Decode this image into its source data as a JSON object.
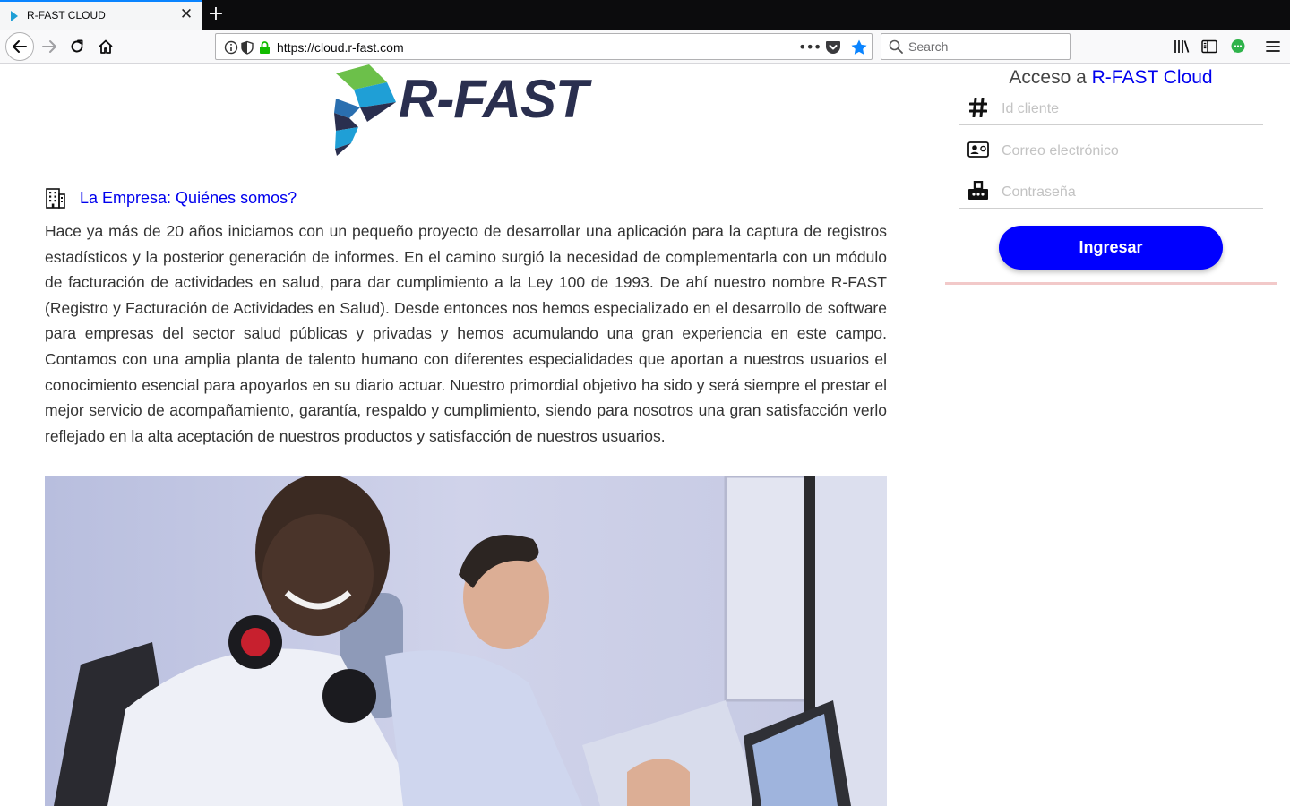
{
  "browser": {
    "tab_title": "R-FAST CLOUD",
    "tab_close": "✕",
    "new_tab": "+",
    "url": "https://cloud.r-fast.com",
    "url_menu": "•••",
    "search_placeholder": "Search"
  },
  "page": {
    "logo_text": "R-FAST",
    "section_title": "La Empresa: Quiénes somos?",
    "about_text": "Hace ya más de 20 años iniciamos con un pequeño proyecto de desarrollar una aplicación para la captura de registros estadísticos y la posterior generación de informes. En el camino surgió la necesidad de complementarla con un módulo de facturación de actividades en salud, para dar cumplimiento a la Ley 100 de 1993. De ahí nuestro nombre R-FAST (Registro y Facturación de Actividades en Salud). Desde entonces nos hemos especializado en el desarrollo de software para empresas del sector salud públicas y privadas y hemos acumulando una gran experiencia en este campo. Contamos con una amplia planta de talento humano con diferentes especialidades que aportan a nuestros usuarios el conocimiento esencial para apoyarlos en su diario actuar. Nuestro primordial objetivo ha sido y será siempre el prestar el mejor servicio de acompañamiento, garantía, respaldo y cumplimiento, siendo para nosotros una gran satisfacción verlo reflejado en la alta aceptación de nuestros productos y satisfacción de nuestros usuarios."
  },
  "login": {
    "title_prefix": "Acceso a ",
    "title_brand": "R-FAST Cloud",
    "client_id_placeholder": "Id cliente",
    "email_placeholder": "Correo electrónico",
    "password_placeholder": "Contraseña",
    "submit_label": "Ingresar"
  },
  "colors": {
    "accent_link": "#0000ee",
    "button": "#0000ff",
    "logo_dark": "#2a2f4f",
    "logo_green": "#6cc04a",
    "logo_blue": "#1f9fd6"
  }
}
